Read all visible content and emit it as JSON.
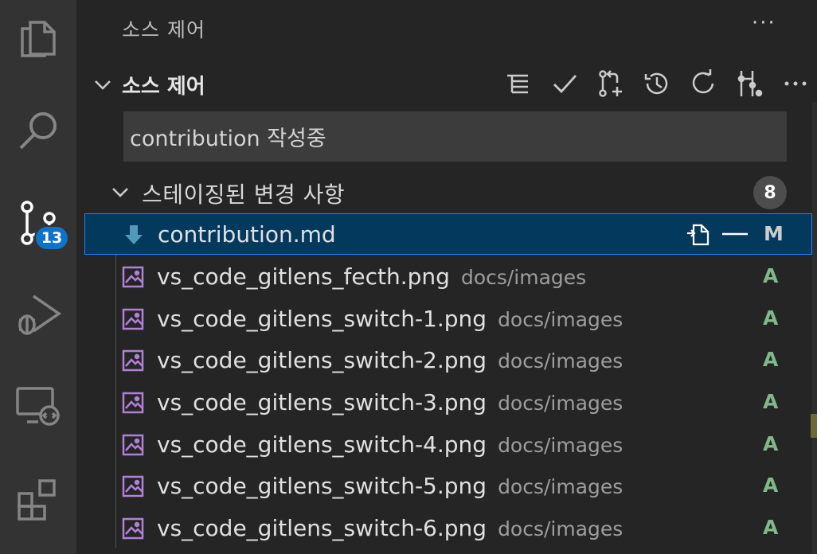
{
  "activity_bar": {
    "items": [
      {
        "icon": "files-icon"
      },
      {
        "icon": "search-icon"
      },
      {
        "icon": "source-control-icon",
        "badge": "13"
      },
      {
        "icon": "run-debug-icon"
      },
      {
        "icon": "remote-explorer-icon"
      },
      {
        "icon": "extensions-icon"
      }
    ]
  },
  "sidebar": {
    "title": "소스 제어",
    "more": "···"
  },
  "section": {
    "name": "소스 제어",
    "more": "···",
    "toolbar": [
      "view-as-tree-icon",
      "commit-check-icon",
      "pull-request-icon",
      "history-icon",
      "refresh-icon",
      "git-graph-icon",
      "more-icon"
    ]
  },
  "commit": {
    "value": "contribution 작성중"
  },
  "staged": {
    "label": "스테이징된 변경 사항",
    "count": "8",
    "files": [
      {
        "name": "contribution.md",
        "dir": "",
        "status": "M",
        "status_color": "#cccccc",
        "icon": "markdown-download-icon"
      },
      {
        "name": "vs_code_gitlens_fecth.png",
        "dir": "docs/images",
        "status": "A",
        "status_color": "#81b88b",
        "icon": "image-icon"
      },
      {
        "name": "vs_code_gitlens_switch-1.png",
        "dir": "docs/images",
        "status": "A",
        "status_color": "#81b88b",
        "icon": "image-icon"
      },
      {
        "name": "vs_code_gitlens_switch-2.png",
        "dir": "docs/images",
        "status": "A",
        "status_color": "#81b88b",
        "icon": "image-icon"
      },
      {
        "name": "vs_code_gitlens_switch-3.png",
        "dir": "docs/images",
        "status": "A",
        "status_color": "#81b88b",
        "icon": "image-icon"
      },
      {
        "name": "vs_code_gitlens_switch-4.png",
        "dir": "docs/images",
        "status": "A",
        "status_color": "#81b88b",
        "icon": "image-icon"
      },
      {
        "name": "vs_code_gitlens_switch-5.png",
        "dir": "docs/images",
        "status": "A",
        "status_color": "#81b88b",
        "icon": "image-icon"
      },
      {
        "name": "vs_code_gitlens_switch-6.png",
        "dir": "docs/images",
        "status": "A",
        "status_color": "#81b88b",
        "icon": "image-icon"
      }
    ]
  },
  "colors": {
    "accent": "#0e73c9",
    "selection": "#04395e",
    "added": "#81b88b",
    "image_icon": "#b180d7"
  }
}
